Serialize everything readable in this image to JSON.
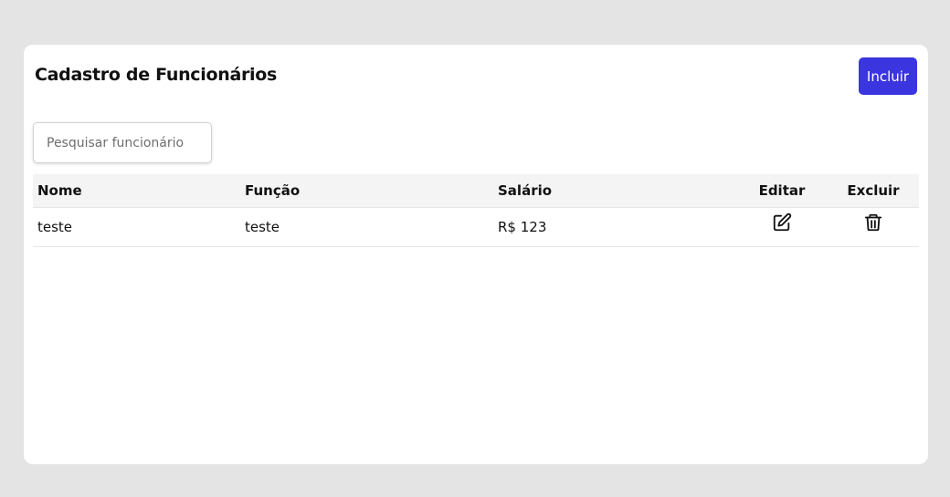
{
  "page": {
    "title": "Cadastro de Funcionários",
    "add_button_label": "Incluir"
  },
  "search": {
    "placeholder": "Pesquisar funcionário",
    "value": ""
  },
  "table": {
    "columns": [
      "Nome",
      "Função",
      "Salário",
      "Editar",
      "Excluir"
    ],
    "rows": [
      {
        "nome": "teste",
        "funcao": "teste",
        "salario": "R$ 123",
        "edit_icon": "edit-icon",
        "delete_icon": "trash-icon"
      }
    ]
  },
  "colors": {
    "background": "#e4e4e4",
    "card": "#ffffff",
    "accent": "#3b35e0",
    "header_row": "#f4f4f4"
  }
}
